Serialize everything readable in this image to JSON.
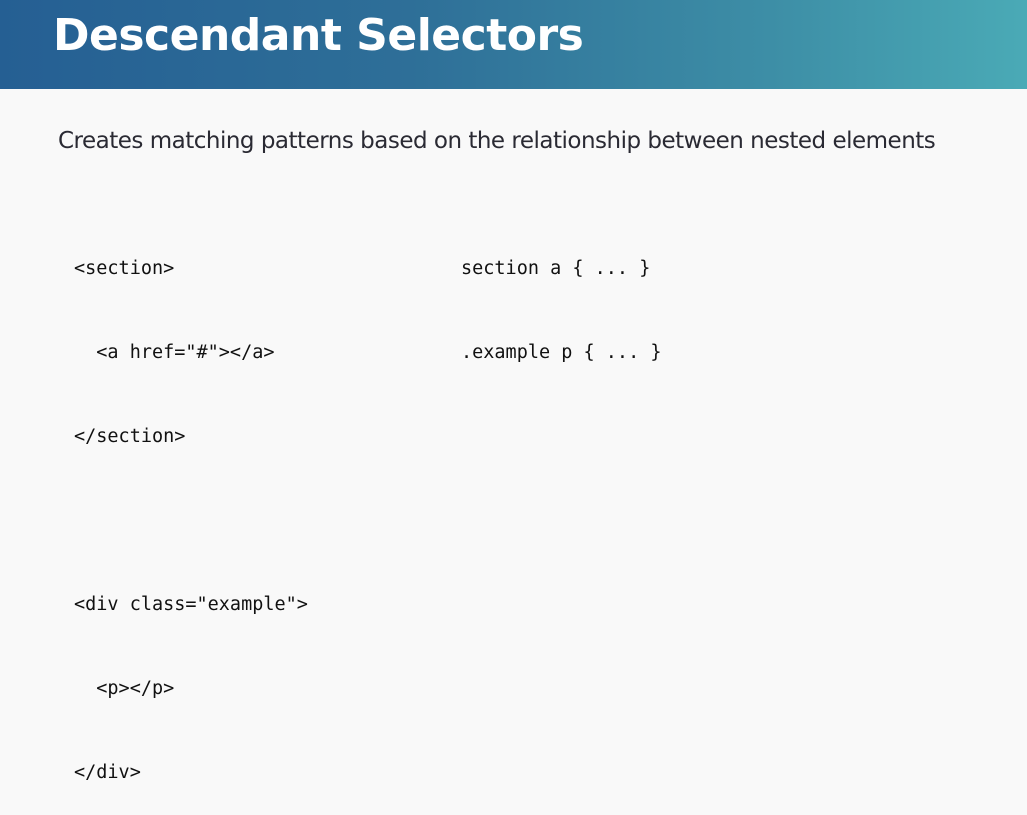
{
  "slide": {
    "title": "Descendant Selectors",
    "subtitle": "Creates matching patterns based on the relationship between nested elements"
  },
  "html_example": {
    "lines": [
      "<section>",
      "  <a href=\"#\"></a>",
      "</section>",
      "",
      "<div class=\"example\">",
      "  <p></p>",
      "</div>"
    ]
  },
  "css_example": {
    "lines": [
      "section a { ... }",
      ".example p { ... }"
    ]
  },
  "colors": {
    "header_start": "#255f93",
    "header_end": "#4aaab6",
    "background": "#f9f9f9",
    "title_text": "#ffffff",
    "body_text": "#2a2a33",
    "code_text": "#111111"
  }
}
